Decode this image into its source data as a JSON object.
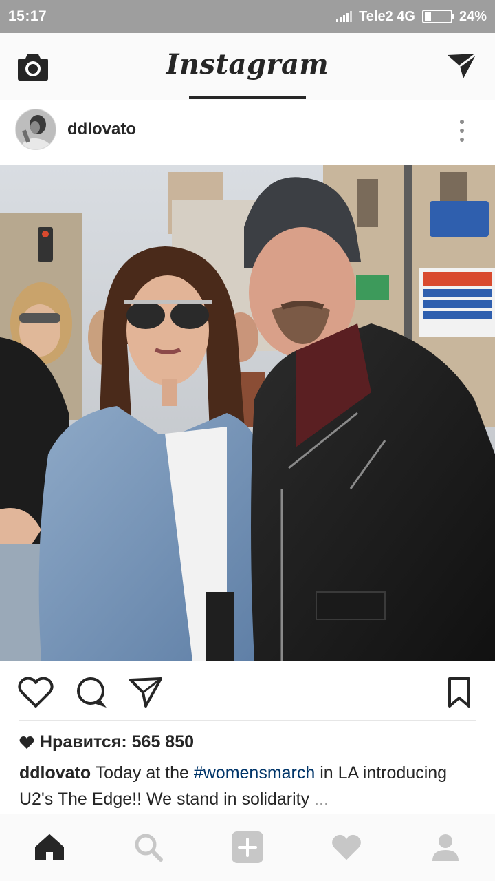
{
  "status_bar": {
    "time": "15:17",
    "carrier": "Tele2 4G",
    "battery_percent": "24%",
    "battery_level": 0.24
  },
  "app_bar": {
    "logo_text": "Instagram",
    "icons": {
      "left": "camera-icon",
      "right": "direct-message-icon"
    }
  },
  "post": {
    "username": "ddlovato",
    "more_icon": "more-vertical-icon",
    "image_description_icons": [
      "photo"
    ],
    "likes_text": "Нравится: 565 850",
    "caption": {
      "username": "ddlovato",
      "text_before_tag": " Today at the ",
      "hashtag": "#womensmarch",
      "text_after_tag": " in LA introducing U2's The Edge!! We stand in solidarity",
      "ellipsis": " ..."
    },
    "actions": [
      "heart-icon",
      "comment-icon",
      "share-icon",
      "bookmark-icon"
    ]
  },
  "bottom_nav": {
    "items": [
      "home-icon",
      "search-icon",
      "add-post-icon",
      "activity-heart-icon",
      "profile-icon"
    ],
    "active": "home-icon"
  },
  "colors": {
    "status_bar_bg": "#9e9e9e",
    "hashtag": "#003569",
    "icon_active": "#262626",
    "icon_inactive": "#c7c7c7"
  }
}
